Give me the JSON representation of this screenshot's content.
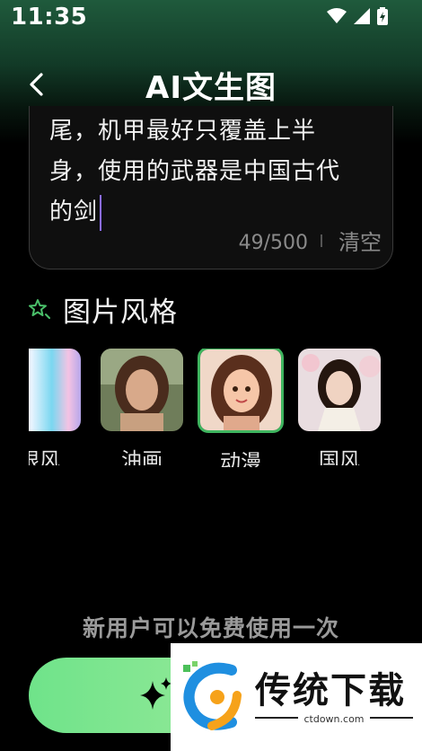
{
  "status_bar": {
    "time": "11:35"
  },
  "nav": {
    "title": "AI文生图"
  },
  "prompt": {
    "lines": [
      "尾，机甲最好只覆盖上半",
      "身，使用的武器是中国古代",
      "的剑"
    ],
    "counter": "49/500",
    "clear_label": "清空"
  },
  "styles": {
    "title": "图片风格",
    "items": [
      {
        "label": "限风",
        "selected": false
      },
      {
        "label": "油画",
        "selected": false
      },
      {
        "label": "动漫",
        "selected": true
      },
      {
        "label": "国风",
        "selected": false
      }
    ]
  },
  "free_hint": "新用户可以免费使用一次",
  "watermark": {
    "brand": "传统下载",
    "url": "ctdown.com"
  },
  "colors": {
    "accent_green": "#3fb55f",
    "button_start": "#6fe38a",
    "caret": "#8c6cff"
  }
}
